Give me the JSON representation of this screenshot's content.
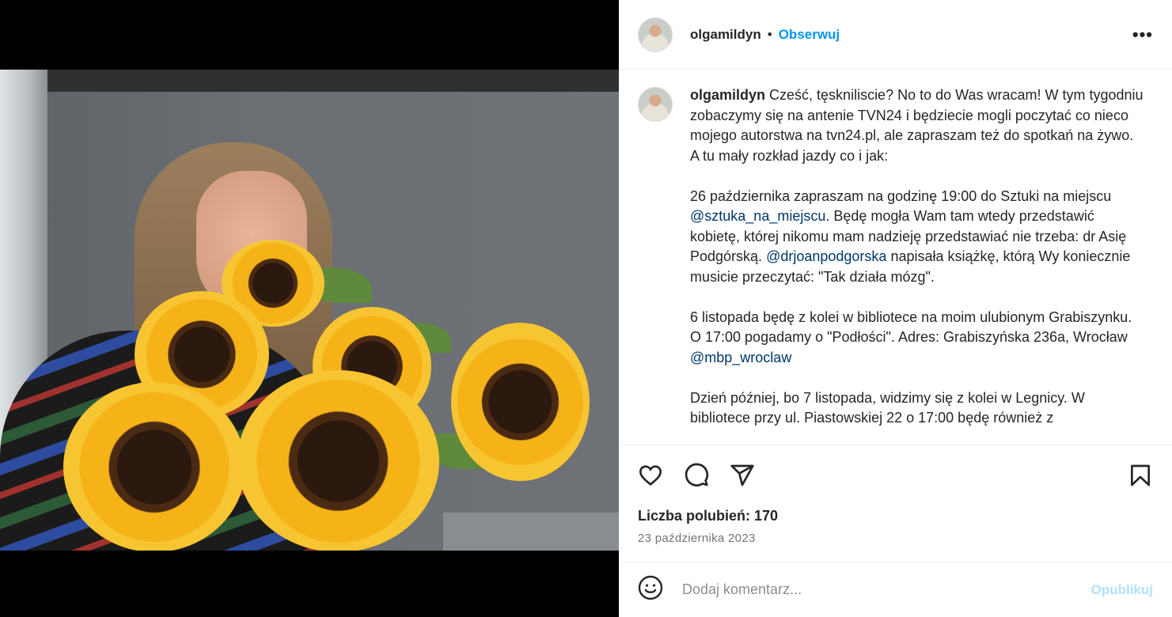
{
  "post": {
    "username": "olgamildyn",
    "separator": "•",
    "follow_label": "Obserwuj",
    "more_label": "•••",
    "photo_alt": "",
    "caption": {
      "username": "olgamildyn",
      "p1": "Cześć, tęskniliscie? No to do Was wracam! W tym tygodniu zobaczymy się na antenie TVN24 i będziecie mogli poczytać co nieco mojego autorstwa na tvn24.pl, ale zapraszam też do spotkań na żywo. A tu mały rozkład jazdy co i jak:",
      "p2_a": "26 października zapraszam na godzinę 19:00 do Sztuki na miejscu ",
      "p2_m1": "@sztuka_na_miejscu",
      "p2_b": ". Będę mogła Wam tam wtedy przedstawić kobietę, której nikomu mam nadzieję przedstawiać nie trzeba: dr Asię Podgórską. ",
      "p2_m2": "@drjoanpodgorska",
      "p2_c": " napisała książkę, którą Wy koniecznie musicie przeczytać: \"Tak działa mózg\".",
      "p3_a": "6 listopada będę z kolei w bibliotece na moim ulubionym Grabiszynku. O 17:00 pogadamy o \"Podłości\". Adres: Grabiszyńska 236a, Wrocław ",
      "p3_m1": "@mbp_wroclaw",
      "p4": "Dzień później, bo 7 listopada, widzimy się z kolei w Legnicy. W bibliotece przy ul. Piastowskiej 22 o 17:00 będę również z"
    },
    "likes_label": "Liczba polubień: 170",
    "date": "23 października 2023",
    "comment_placeholder": "Dodaj komentarz...",
    "publish_label": "Opublikuj"
  },
  "colors": {
    "accent": "#0095f6",
    "mention": "#00376b",
    "publish_disabled": "#b2dffc"
  },
  "icons": [
    "heart-icon",
    "comment-icon",
    "share-icon",
    "bookmark-icon",
    "emoji-icon",
    "more-icon"
  ]
}
